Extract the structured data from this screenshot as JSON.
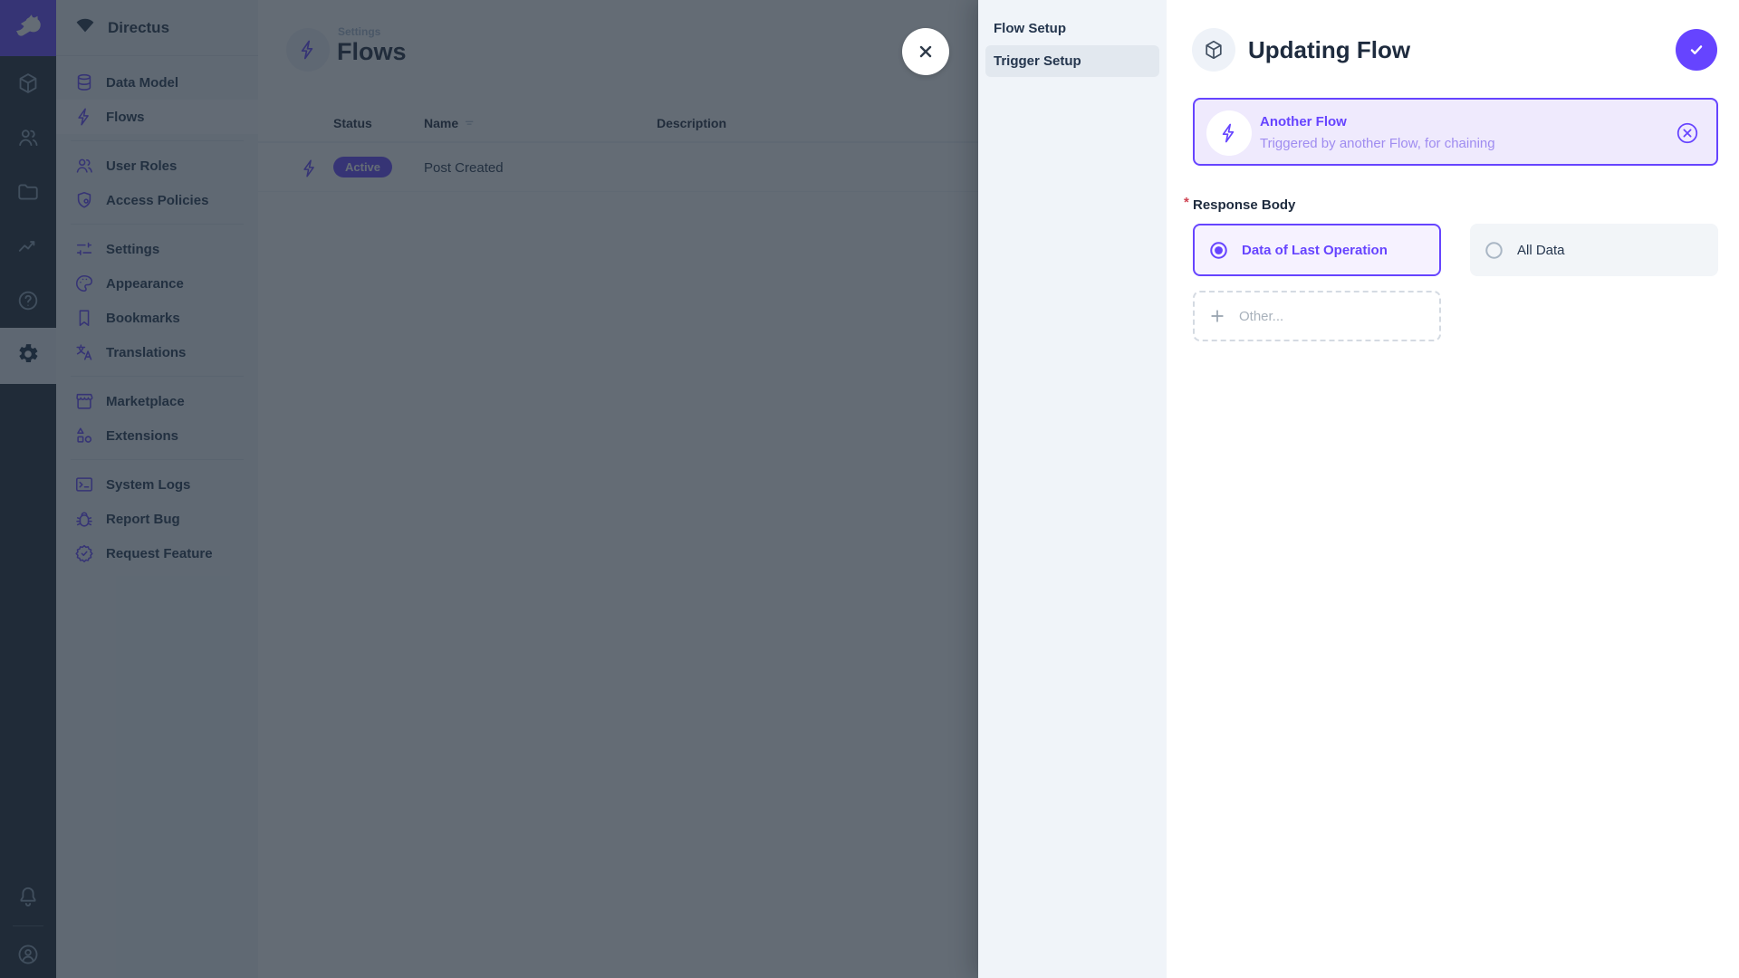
{
  "colors": {
    "accent": "#6644ff",
    "module_bar_bg": "#1c2733",
    "nav_bg": "#f0f4f9",
    "overlay": "rgba(34,46,58,0.7)",
    "trigger_card_bg": "#efeafd",
    "badge_bg": "#6644ff"
  },
  "module_bar": {
    "logo_icon": "directus-rabbit-logo-icon",
    "modules": [
      {
        "icon": "content-cube-icon"
      },
      {
        "icon": "users-icon"
      },
      {
        "icon": "files-folder-icon"
      },
      {
        "icon": "insights-chart-icon"
      },
      {
        "icon": "help-question-icon"
      },
      {
        "icon": "settings-gear-icon",
        "active": true
      }
    ],
    "bottom": [
      {
        "icon": "notifications-bell-icon"
      },
      {
        "icon": "account-avatar-icon"
      }
    ]
  },
  "sidebar": {
    "project_name": "Directus",
    "project_icon": "project-status-fan-icon",
    "sections": [
      {
        "items": [
          {
            "icon": "database-icon",
            "label": "Data Model"
          },
          {
            "icon": "bolt-icon",
            "label": "Flows",
            "active": true
          }
        ]
      },
      {
        "items": [
          {
            "icon": "user-roles-icon",
            "label": "User Roles"
          },
          {
            "icon": "shield-icon",
            "label": "Access Policies"
          }
        ]
      },
      {
        "items": [
          {
            "icon": "tune-sliders-icon",
            "label": "Settings"
          },
          {
            "icon": "palette-icon",
            "label": "Appearance"
          },
          {
            "icon": "bookmark-icon",
            "label": "Bookmarks"
          },
          {
            "icon": "translate-icon",
            "label": "Translations"
          }
        ]
      },
      {
        "items": [
          {
            "icon": "storefront-icon",
            "label": "Marketplace"
          },
          {
            "icon": "shapes-icon",
            "label": "Extensions"
          }
        ]
      },
      {
        "items": [
          {
            "icon": "terminal-icon",
            "label": "System Logs"
          },
          {
            "icon": "bug-icon",
            "label": "Report Bug"
          },
          {
            "icon": "verified-badge-icon",
            "label": "Request Feature"
          }
        ]
      }
    ]
  },
  "content": {
    "breadcrumb": "Settings",
    "title": "Flows",
    "title_icon": "bolt-icon",
    "table": {
      "columns": {
        "status": "Status",
        "name": "Name",
        "description": "Description"
      },
      "rows": [
        {
          "icon": "bolt-icon",
          "status": "Active",
          "name": "Post Created",
          "description": ""
        }
      ]
    }
  },
  "drawer": {
    "close_icon": "close-x-icon",
    "nav": [
      {
        "label": "Flow Setup"
      },
      {
        "label": "Trigger Setup",
        "active": true
      }
    ],
    "title": "Updating Flow",
    "title_icon": "box-cube-icon",
    "save_icon": "check-icon",
    "trigger_card": {
      "icon": "bolt-icon",
      "title": "Another Flow",
      "subtitle": "Triggered by another Flow, for chaining",
      "remove_icon": "circled-x-icon"
    },
    "response_body": {
      "label": "Response Body",
      "required_marker": "*",
      "options": [
        {
          "label": "Data of Last Operation",
          "selected": true
        },
        {
          "label": "All Data",
          "selected": false
        }
      ],
      "other_label": "Other..."
    }
  }
}
